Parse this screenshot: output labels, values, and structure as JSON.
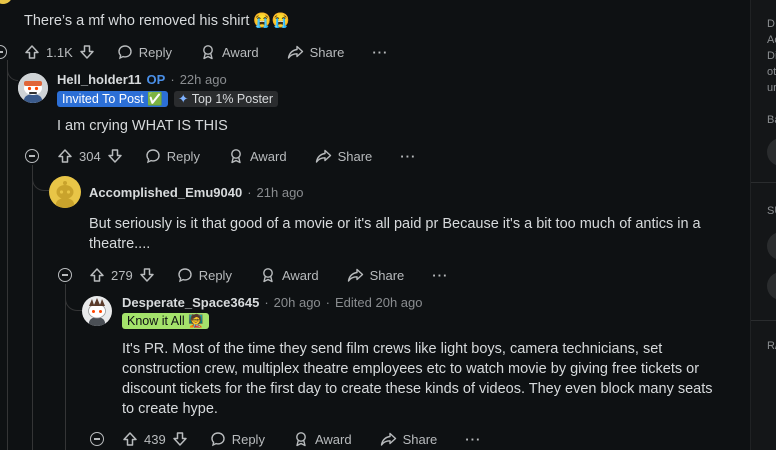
{
  "top_comment": {
    "body": "There’s a mf who removed his shirt 😭😭",
    "votes": "1.1K"
  },
  "comments": [
    {
      "author": "Hell_holder11",
      "op_badge": "OP",
      "time": "22h ago",
      "flair": "Invited To Post ✅",
      "badge": "Top 1% Poster",
      "body": "I am crying WHAT IS THIS",
      "votes": "304"
    },
    {
      "author": "Accomplished_Emu9040",
      "time": "21h ago",
      "body": "But seriously is it that good of a movie or it's all paid pr  Because it's a bit too much of antics in a theatre....",
      "votes": "279"
    },
    {
      "author": "Desperate_Space3645",
      "time": "20h ago",
      "edited": "Edited 20h ago",
      "flair": "Know it All 🧑‍🏫",
      "body": "It's PR. Most of the time they send film crews like light boys, camera technicians, set construction crew, multiplex theatre employees etc to watch movie by giving free tickets or discount tickets for the first day to create these kinds of videos. They even block many seats to create hype.",
      "votes": "439"
    }
  ],
  "actions": {
    "reply": "Reply",
    "award": "Award",
    "share": "Share",
    "more": "···"
  },
  "sidebar": {
    "line1": "D",
    "line2": "Ac",
    "line3": "Di",
    "line4": "ot",
    "line5": "ur",
    "heading1": "Ba",
    "heading2": "SU",
    "heading3": "R/"
  },
  "colors": {
    "background": "#0e1113",
    "op": "#4a8fe7",
    "invited_flair": "#2c6fd6",
    "know_flair": "#a4e36b"
  }
}
